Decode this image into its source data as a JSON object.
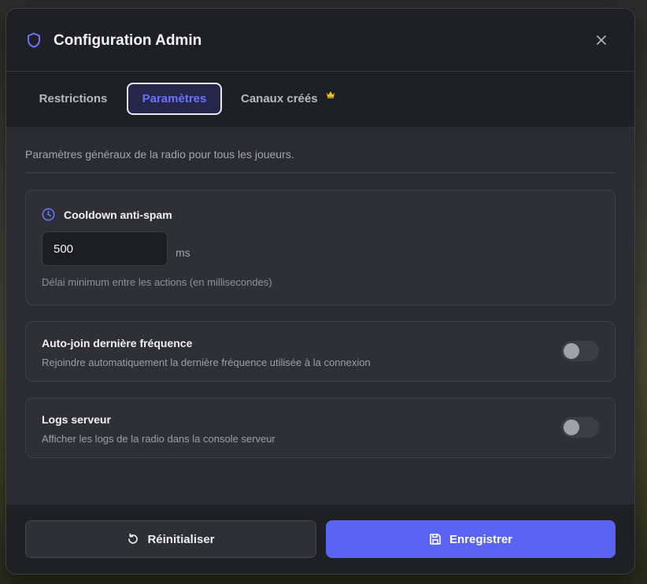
{
  "modal": {
    "title": "Configuration Admin",
    "icon": "shield-icon",
    "accent_color": "#5b63f2"
  },
  "tabs": [
    {
      "label": "Restrictions",
      "active": false
    },
    {
      "label": "Paramètres",
      "active": true
    },
    {
      "label": "Canaux créés",
      "active": false,
      "badge_icon": "crown-icon"
    }
  ],
  "settings": {
    "description": "Paramètres généraux de la radio pour tous les joueurs.",
    "cooldown": {
      "title": "Cooldown anti-spam",
      "icon": "clock-icon",
      "value": "500",
      "unit": "ms",
      "hint": "Délai minimum entre les actions (en millisecondes)"
    },
    "autojoin": {
      "title": "Auto-join dernière fréquence",
      "description": "Rejoindre automatiquement la dernière fréquence utilisée à la connexion",
      "enabled": false
    },
    "logs": {
      "title": "Logs serveur",
      "description": "Afficher les logs de la radio dans la console serveur",
      "enabled": false
    }
  },
  "footer": {
    "reset_label": "Réinitialiser",
    "reset_icon": "rotate-ccw-icon",
    "save_label": "Enregistrer",
    "save_icon": "save-icon"
  }
}
